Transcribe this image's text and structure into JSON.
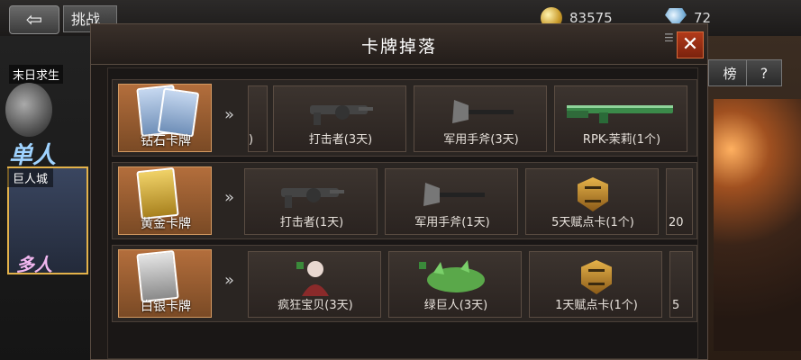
{
  "topbar": {
    "back_glyph": "⇦",
    "challenge_label": "挑战",
    "gold_value": "83575",
    "diamond_value": "72"
  },
  "left_panel": {
    "mode_tag": "末日求生",
    "mode_big": "单人",
    "city_tag": "巨人城",
    "city_big": "多人"
  },
  "right_panel": {
    "rank_label": "榜",
    "help_label": "?"
  },
  "modal": {
    "title": "卡牌掉落",
    "close_glyph": "✕",
    "menu_glyph": "☰",
    "chevron": "»"
  },
  "rows": [
    {
      "card": "钻石卡牌",
      "card_color": "#9ab4d8",
      "items": [
        ")",
        "打击者(3天)",
        "军用手斧(3天)",
        "RPK-茉莉(1个)"
      ]
    },
    {
      "card": "黄金卡牌",
      "card_color": "#e6bf4a",
      "items": [
        "打击者(1天)",
        "军用手斧(1天)",
        "5天赋点卡(1个)",
        "20"
      ]
    },
    {
      "card": "白银卡牌",
      "card_color": "#b8b8b8",
      "items": [
        "疯狂宝贝(3天)",
        "绿巨人(3天)",
        "1天赋点卡(1个)",
        "5"
      ]
    }
  ]
}
